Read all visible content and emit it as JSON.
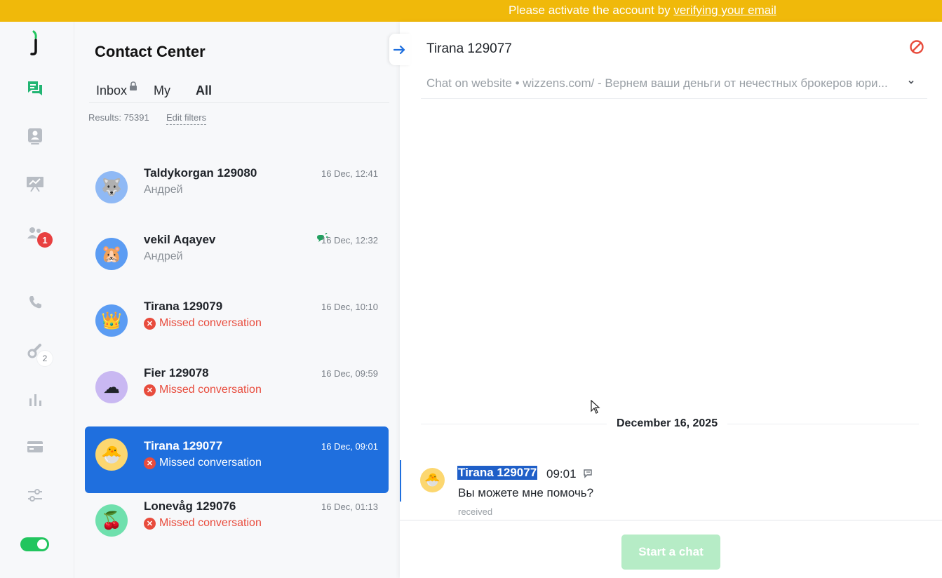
{
  "banner": {
    "text": "Please activate the account by ",
    "link": "verifying your email",
    "color": "#f0b90a"
  },
  "rail": {
    "logo": "j",
    "items": [
      {
        "icon": "chat-icon",
        "active": true
      },
      {
        "icon": "contacts-icon"
      },
      {
        "icon": "presentation-icon"
      },
      {
        "icon": "team-icon",
        "badge": "1"
      },
      {
        "icon": "phone-icon"
      },
      {
        "icon": "integrations-icon",
        "badge": "2"
      },
      {
        "icon": "analytics-icon"
      },
      {
        "icon": "billing-icon"
      },
      {
        "icon": "settings-icon"
      }
    ],
    "team_badge": "1",
    "integrations_badge": "2",
    "status_toggle": "on"
  },
  "list": {
    "title": "Contact Center",
    "tabs": [
      "Inbox",
      "My",
      "All"
    ],
    "active_tab": "All",
    "results": "Results: 75391",
    "edit_filters": "Edit filters",
    "conversations": [
      {
        "name": "Taldykorgan 129080",
        "time": "16 Dec, 12:41",
        "sub": "Андрей",
        "avatar": "🐺",
        "avatar_color": "#8fb9f5"
      },
      {
        "name": "vekil Aqayev",
        "time": "16 Dec, 12:32",
        "sub": "Андрей",
        "avatar": "🐹",
        "avatar_color": "#5b9cf3"
      },
      {
        "name": "Tirana 129079",
        "time": "16 Dec, 10:10",
        "sub": "Missed conversation",
        "avatar": "👑",
        "avatar_color": "#5b9cf3"
      },
      {
        "name": "Fier 129078",
        "time": "16 Dec, 09:59",
        "sub": "Missed conversation",
        "avatar": "☁",
        "avatar_color": "#c9b8f2"
      },
      {
        "name": "Tirana 129077",
        "time": "16 Dec, 09:01",
        "sub": "Missed conversation",
        "avatar": "🐣",
        "avatar_color": "#fcd770",
        "selected": true
      },
      {
        "name": "Lonevåg 129076",
        "time": "16 Dec, 01:13",
        "sub": "Missed conversation",
        "avatar": "🍒",
        "avatar_color": "#6fe0ad"
      }
    ]
  },
  "chat": {
    "title": "Tirana 129077",
    "meta": "Chat on website • wizzens.com/ - Вернем ваши деньги от нечестных брокеров юри...",
    "date": "December 16, 2025",
    "message": {
      "sender": "Tirana 129077",
      "time": "09:01",
      "text": "Вы можете мне помочь?",
      "status": "received",
      "avatar": "🐣"
    },
    "start_button": "Start a chat"
  },
  "colors": {
    "accent": "#1f6fde",
    "brand_green": "#22c55e",
    "missed": "#e84c3d"
  }
}
